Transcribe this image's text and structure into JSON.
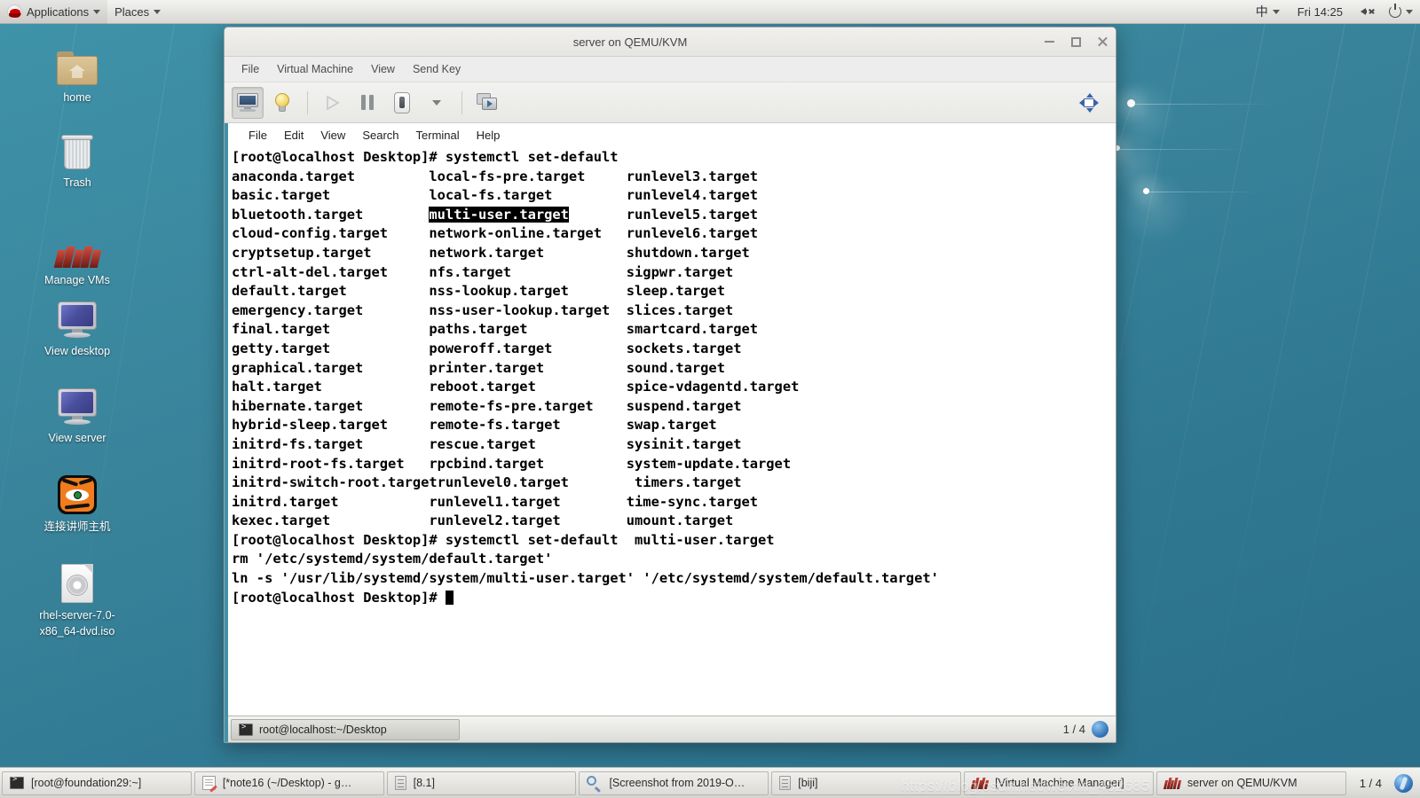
{
  "top_panel": {
    "logo": "redhat-logo",
    "applications": "Applications",
    "places": "Places",
    "ime": "中",
    "clock": "Fri 14:25",
    "volume_icon": "volume-muted-icon",
    "power_icon": "power-icon"
  },
  "desktop_icons": [
    {
      "label": "home",
      "icon": "home-folder-icon"
    },
    {
      "label": "Trash",
      "icon": "trash-icon"
    },
    {
      "label": "Manage VMs",
      "icon": "virt-manager-icon"
    },
    {
      "label": "View desktop",
      "icon": "monitor-icon"
    },
    {
      "label": "View server",
      "icon": "monitor-icon"
    },
    {
      "label": "连接讲师主机",
      "icon": "tigervnc-icon"
    },
    {
      "label": "rhel-server-7.0-x86_64-dvd.iso",
      "icon": "iso-disc-icon"
    }
  ],
  "vm_window": {
    "title": "server on QEMU/KVM",
    "menu": [
      "File",
      "Virtual Machine",
      "View",
      "Send Key"
    ],
    "toolbar": [
      {
        "name": "console-view-button",
        "icon": "monitor-icon",
        "state": "active"
      },
      {
        "name": "details-view-button",
        "icon": "lightbulb-icon",
        "state": "normal"
      },
      {
        "name": "run-button",
        "icon": "play-icon",
        "state": "disabled"
      },
      {
        "name": "pause-button",
        "icon": "pause-icon",
        "state": "normal"
      },
      {
        "name": "shutdown-button",
        "icon": "power-switch-icon",
        "state": "normal"
      },
      {
        "name": "shutdown-menu-button",
        "icon": "chevron-down-icon",
        "state": "normal"
      },
      {
        "name": "snapshots-button",
        "icon": "snapshots-icon",
        "state": "normal"
      },
      {
        "name": "fullscreen-button",
        "icon": "resize-arrows-icon",
        "state": "normal"
      }
    ],
    "window_controls": {
      "minimize": "minimize-icon",
      "maximize": "maximize-icon",
      "close": "close-icon"
    }
  },
  "guest": {
    "menu": [
      "File",
      "Edit",
      "View",
      "Search",
      "Terminal",
      "Help"
    ],
    "terminal": {
      "prompt_line": "[root@localhost Desktop]# systemctl set-default",
      "columns": [
        [
          "anaconda.target",
          "basic.target",
          "bluetooth.target",
          "cloud-config.target",
          "cryptsetup.target",
          "ctrl-alt-del.target",
          "default.target",
          "emergency.target",
          "final.target",
          "getty.target",
          "graphical.target",
          "halt.target",
          "hibernate.target",
          "hybrid-sleep.target",
          "initrd-fs.target",
          "initrd-root-fs.target",
          "initrd-switch-root.target",
          "initrd.target",
          "kexec.target"
        ],
        [
          "local-fs-pre.target",
          "local-fs.target",
          "multi-user.target",
          "network-online.target",
          "network.target",
          "nfs.target",
          "nss-lookup.target",
          "nss-user-lookup.target",
          "paths.target",
          "poweroff.target",
          "printer.target",
          "reboot.target",
          "remote-fs-pre.target",
          "remote-fs.target",
          "rescue.target",
          "rpcbind.target",
          "runlevel0.target",
          "runlevel1.target",
          "runlevel2.target"
        ],
        [
          "runlevel3.target",
          "runlevel4.target",
          "runlevel5.target",
          "runlevel6.target",
          "shutdown.target",
          "sigpwr.target",
          "sleep.target",
          "slices.target",
          "smartcard.target",
          "sockets.target",
          "sound.target",
          "spice-vdagentd.target",
          "suspend.target",
          "swap.target",
          "sysinit.target",
          "system-update.target",
          "timers.target",
          "time-sync.target",
          "umount.target"
        ]
      ],
      "highlighted_item": "multi-user.target",
      "after_lines": [
        "[root@localhost Desktop]# systemctl set-default  multi-user.target",
        "rm '/etc/systemd/system/default.target'",
        "ln -s '/usr/lib/systemd/system/multi-user.target' '/etc/systemd/system/default.target'"
      ],
      "final_prompt": "[root@localhost Desktop]# "
    },
    "taskbar": {
      "window_title": "root@localhost:~/Desktop",
      "window_icon": "terminal-icon",
      "pager": "1 / 4"
    }
  },
  "taskbar": {
    "items": [
      {
        "label": "[root@foundation29:~]",
        "icon": "terminal-icon"
      },
      {
        "label": "[*note16 (~/Desktop) - g…",
        "icon": "notes-icon"
      },
      {
        "label": "[8.1]",
        "icon": "file-icon"
      },
      {
        "label": "[Screenshot from 2019-O…",
        "icon": "screenshot-icon"
      },
      {
        "label": "[biji]",
        "icon": "file-icon"
      },
      {
        "label": "[Virtual Machine Manager]",
        "icon": "virt-manager-icon"
      },
      {
        "label": "server on QEMU/KVM",
        "icon": "virt-manager-icon"
      }
    ],
    "pager": "1 / 4",
    "notification_icon": "notification-badge-icon"
  },
  "watermark": "https://blog.csdn.net/weixin_452685",
  "colors": {
    "desktop": "#3f93a9",
    "panel": "#e6e5e2",
    "accent_border": "#3f93a9",
    "terminal_bg": "#ffffff",
    "terminal_fg": "#000000"
  }
}
